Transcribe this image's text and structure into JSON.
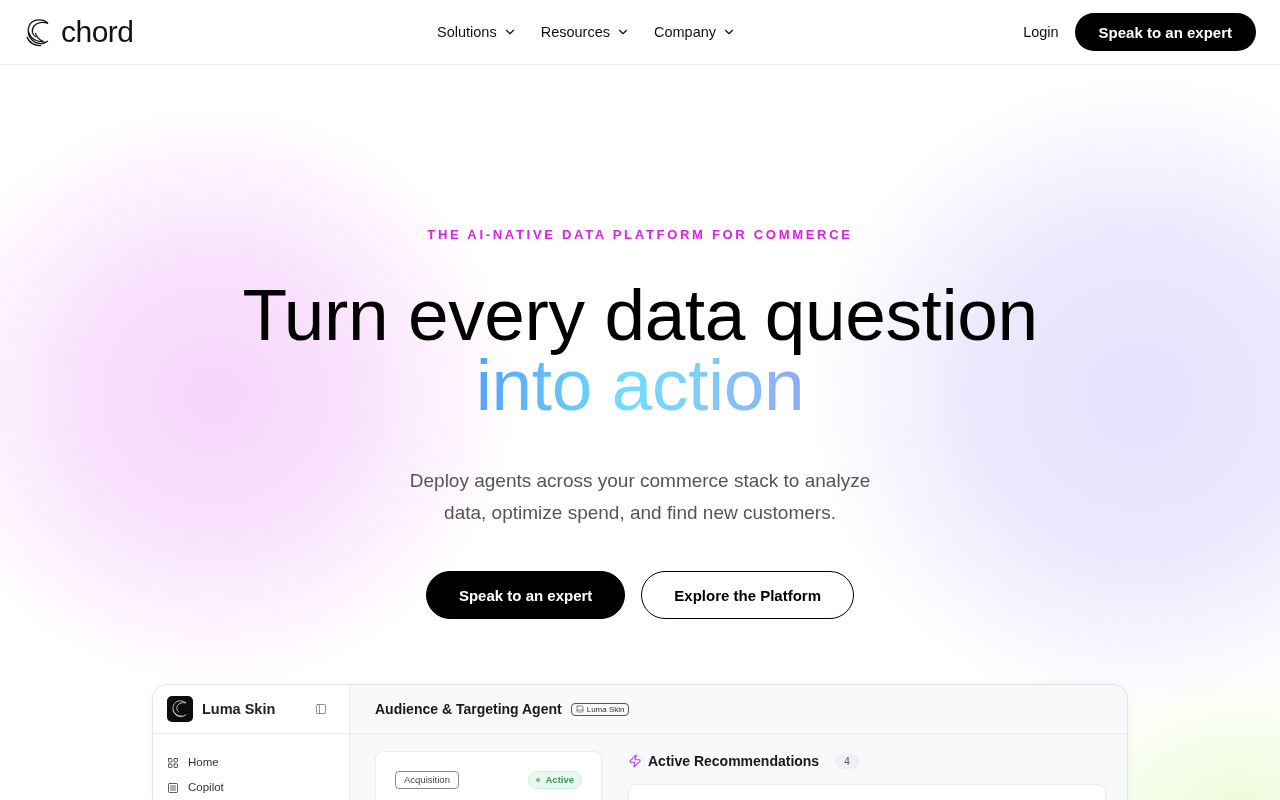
{
  "header": {
    "logo": {
      "wordmark": "chord"
    },
    "nav": [
      {
        "label": "Solutions"
      },
      {
        "label": "Resources"
      },
      {
        "label": "Company"
      }
    ],
    "login": "Login",
    "cta": "Speak to an expert"
  },
  "hero": {
    "eyebrow": "THE AI-NATIVE DATA PLATFORM FOR COMMERCE",
    "headline": "Turn every data question",
    "headline_accent": "into action",
    "subtitle": "Deploy agents across your commerce stack to analyze data, optimize spend, and find new customers.",
    "buttons": [
      {
        "label": "Speak to an expert",
        "kind": "primary"
      },
      {
        "label": "Explore the Platform",
        "kind": "secondary"
      }
    ]
  },
  "dashboard": {
    "workspace": "Luma Skin",
    "sidebar": {
      "items": [
        {
          "label": "Home",
          "kind": "home",
          "selected": false
        },
        {
          "label": "Copilot",
          "kind": "copilot",
          "selected": false
        }
      ]
    },
    "title": "Audience & Targeting Agent",
    "title_tag": "Luma Skin",
    "agent_card": {
      "tag": "Acquisition",
      "status": "Active"
    },
    "recommendations": {
      "title": "Active Recommendations",
      "count": "4"
    }
  }
}
